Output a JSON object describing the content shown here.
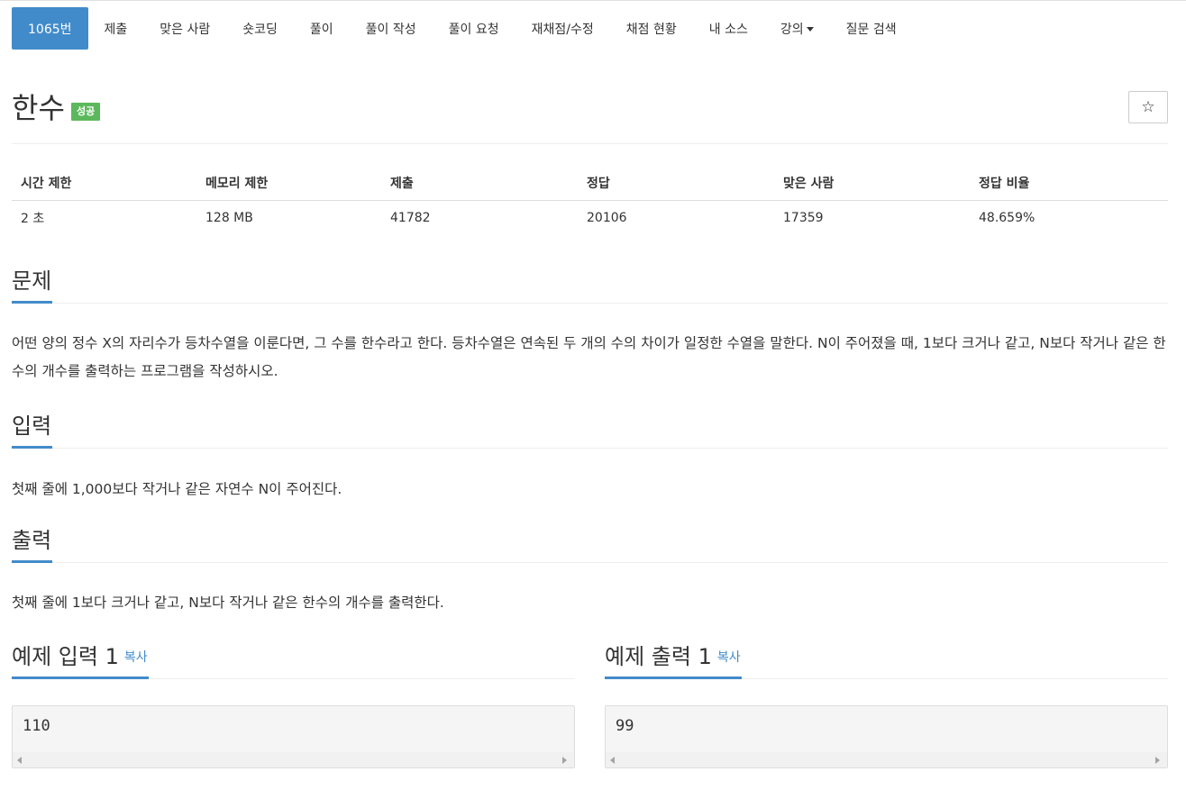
{
  "nav": {
    "tabs": [
      {
        "label": "1065번"
      },
      {
        "label": "제출"
      },
      {
        "label": "맞은 사람"
      },
      {
        "label": "숏코딩"
      },
      {
        "label": "풀이"
      },
      {
        "label": "풀이 작성"
      },
      {
        "label": "풀이 요청"
      },
      {
        "label": "재채점/수정"
      },
      {
        "label": "채점 현황"
      },
      {
        "label": "내 소스"
      },
      {
        "label": "강의"
      },
      {
        "label": "질문 검색"
      }
    ],
    "active_color": "#428bca"
  },
  "problem": {
    "title": "한수",
    "badge": "성공",
    "badge_color": "#5cb85c",
    "star_icon": "star-icon"
  },
  "info_table": {
    "headers": [
      "시간 제한",
      "메모리 제한",
      "제출",
      "정답",
      "맞은 사람",
      "정답 비율"
    ],
    "values": [
      "2 초",
      "128 MB",
      "41782",
      "20106",
      "17359",
      "48.659%"
    ]
  },
  "sections": {
    "description_title": "문제",
    "description": "어떤 양의 정수 X의 자리수가 등차수열을 이룬다면, 그 수를 한수라고 한다. 등차수열은 연속된 두 개의 수의 차이가 일정한 수열을 말한다. N이 주어졌을 때, 1보다 크거나 같고, N보다 작거나 같은 한수의 개수를 출력하는 프로그램을 작성하시오.",
    "input_title": "입력",
    "input": "첫째 줄에 1,000보다 작거나 같은 자연수 N이 주어진다.",
    "output_title": "출력",
    "output": "첫째 줄에 1보다 크거나 같고, N보다 작거나 같은 한수의 개수를 출력한다."
  },
  "samples": {
    "input_title": "예제 입력 1",
    "output_title": "예제 출력 1",
    "copy_label": "복사",
    "input_value": "110",
    "output_value": "99"
  }
}
